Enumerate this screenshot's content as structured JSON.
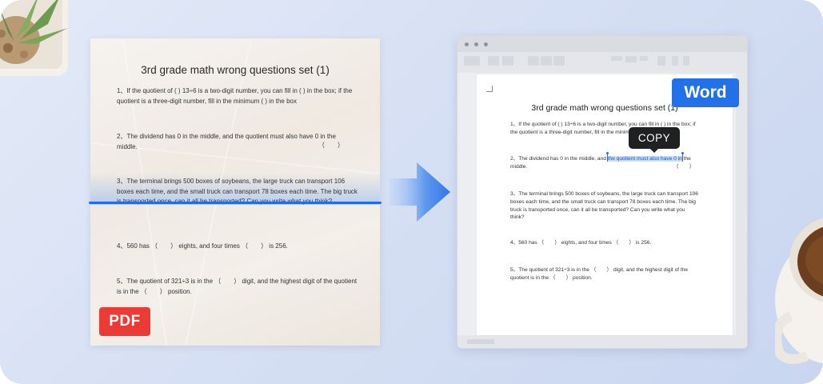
{
  "pdf": {
    "title": "3rd grade math wrong questions set (1)",
    "q1": "1、If the quotient of ( ) 13÷6 is a two-digit number, you can fill in ( ) in the box; if the quotient is a three-digit number, fill in the minimum ( ) in the box",
    "q2": "2、The dividend has 0 in the middle, and the quotient must also have 0 in the middle.",
    "q3": "3、The terminal brings 500 boxes of soybeans, the large truck can transport 106 boxes each time, and the small truck can transport 78 boxes each time. The big truck is transported once, can it all be transported? Can you write what you think?",
    "q4": "4、560 has （　　） eights, and four times （　　） is 256.",
    "q5": "5、The quotient of 321÷3 is in the （　　） digit, and the highest digit of the quotient is in the （　　） position.",
    "paren": "（　　）",
    "badge": "PDF"
  },
  "word": {
    "title": "3rd grade math wrong questions set (1)",
    "q1": "1、If the quotient of ( ) 13÷6 is a two-digit number, you can fill in ( ) in the box; if the quotient is a three-digit number, fill in the minimum ( ) in the box",
    "q2_before": "2、The dividend has 0 in the middle, and ",
    "q2_selected": "the quotient must also have 0 in",
    "q2_after": " the middle.",
    "q3": "3、The terminal brings 500 boxes of soybeans, the large truck can transport 106 boxes each time, and the small truck can transport 78 boxes each time. The big truck is transported once, can it all be transported? Can you write what you think?",
    "q4": "4、560 has （　　） eights, and four times （　　） is 256.",
    "q5": "5、The quotient of 321÷3 is in the （　　） digit, and the highest digit of the quotient is in the （　　） position.",
    "paren": "（　　）",
    "copy_label": "COPY",
    "badge": "Word"
  },
  "colors": {
    "pdf_badge": "#ec3a35",
    "word_badge": "#2271e8",
    "scan_line": "#1f6cf0",
    "selection": "#c6dcf8"
  },
  "icons": [
    "plant-decor",
    "arrow-right-icon",
    "coffee-cup-decor"
  ]
}
